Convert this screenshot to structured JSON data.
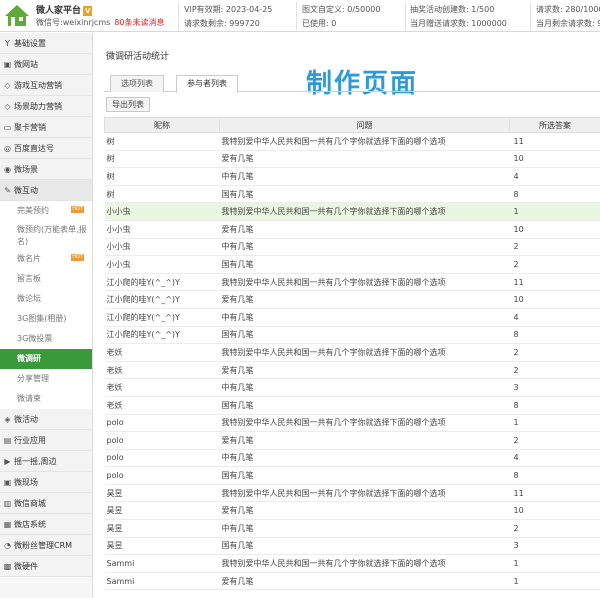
{
  "header": {
    "brand": "微人家平台",
    "vip_badge": "V",
    "wechat_id": "微信号:weixinrjcms",
    "unread": "80条未读消息",
    "stats": [
      {
        "label": "VIP有效期:",
        "value": "2023-04-25"
      },
      {
        "label": "请求数剩余:",
        "value": "999720"
      },
      {
        "label": "图文自定义:",
        "value": "0/50000"
      },
      {
        "label": "已使用:",
        "value": "0"
      },
      {
        "label": "抽奖活动创建数:",
        "value": "1/500"
      },
      {
        "label": "当月赠送请求数:",
        "value": "1000000"
      },
      {
        "label": "请求数:",
        "value": "280/1000"
      },
      {
        "label": "当月剩余请求数:",
        "value": "99"
      }
    ]
  },
  "sidebar": {
    "items": [
      {
        "icon": "Y",
        "label": "基础设置"
      },
      {
        "icon": "▣",
        "label": "微网站"
      },
      {
        "icon": "◇",
        "label": "游戏互动营销"
      },
      {
        "icon": "◇",
        "label": "场景助力营销"
      },
      {
        "icon": "▭",
        "label": "聚卡营销"
      },
      {
        "icon": "◎",
        "label": "百度直达号"
      },
      {
        "icon": "◉",
        "label": "微场景"
      },
      {
        "icon": "✎",
        "label": "微互动"
      }
    ],
    "sub_items": [
      {
        "label": "完美预约",
        "hot": "HOT"
      },
      {
        "label": "微预约(万能表单,报名)",
        "hot": ""
      },
      {
        "label": "微名片",
        "hot": "HOT"
      },
      {
        "label": "留言板",
        "hot": ""
      },
      {
        "label": "微论坛",
        "hot": ""
      },
      {
        "label": "3G图集(相册)",
        "hot": ""
      },
      {
        "label": "3G微投票",
        "hot": ""
      },
      {
        "label": "微调研",
        "hot": ""
      },
      {
        "label": "分享管理",
        "hot": ""
      },
      {
        "label": "微请柬",
        "hot": ""
      }
    ],
    "items_after": [
      {
        "icon": "◈",
        "label": "微活动"
      },
      {
        "icon": "▤",
        "label": "行业应用"
      },
      {
        "icon": "▶",
        "label": "摇一摇,周边"
      },
      {
        "icon": "▣",
        "label": "微现场"
      },
      {
        "icon": "▥",
        "label": "微信商城"
      },
      {
        "icon": "▦",
        "label": "微店系统"
      },
      {
        "icon": "◔",
        "label": "微粉丝管理CRM"
      },
      {
        "icon": "▩",
        "label": "微硬件"
      }
    ]
  },
  "main": {
    "title": "微调研活动统计",
    "banner": "制作页面",
    "tabs": [
      "选项列表",
      "参与者列表"
    ],
    "export_button": "导出列表",
    "columns": [
      "昵称",
      "问题",
      "所选答案"
    ],
    "rows": [
      [
        "树",
        "我特别爱中华人民共和国一共有几个字你就选择下面的哪个选项",
        "11"
      ],
      [
        "树",
        "爱有几笔",
        "10"
      ],
      [
        "树",
        "中有几笔",
        "4"
      ],
      [
        "树",
        "国有几笔",
        "8"
      ],
      [
        "小小虫",
        "我特别爱中华人民共和国一共有几个字你就选择下面的哪个选项",
        "1"
      ],
      [
        "小小虫",
        "爱有几笔",
        "10"
      ],
      [
        "小小虫",
        "中有几笔",
        "2"
      ],
      [
        "小小虫",
        "国有几笔",
        "2"
      ],
      [
        "江小爬的哇Y(^_^)Y",
        "我特别爱中华人民共和国一共有几个字你就选择下面的哪个选项",
        "11"
      ],
      [
        "江小爬的哇Y(^_^)Y",
        "爱有几笔",
        "10"
      ],
      [
        "江小爬的哇Y(^_^)Y",
        "中有几笔",
        "4"
      ],
      [
        "江小爬的哇Y(^_^)Y",
        "国有几笔",
        "8"
      ],
      [
        "老妖",
        "我特别爱中华人民共和国一共有几个字你就选择下面的哪个选项",
        "2"
      ],
      [
        "老妖",
        "爱有几笔",
        "2"
      ],
      [
        "老妖",
        "中有几笔",
        "3"
      ],
      [
        "老妖",
        "国有几笔",
        "8"
      ],
      [
        "polo",
        "我特别爱中华人民共和国一共有几个字你就选择下面的哪个选项",
        "1"
      ],
      [
        "polo",
        "爱有几笔",
        "2"
      ],
      [
        "polo",
        "中有几笔",
        "4"
      ],
      [
        "polo",
        "国有几笔",
        "8"
      ],
      [
        "昊昱",
        "我特别爱中华人民共和国一共有几个字你就选择下面的哪个选项",
        "11"
      ],
      [
        "昊昱",
        "爱有几笔",
        "10"
      ],
      [
        "昊昱",
        "中有几笔",
        "2"
      ],
      [
        "昊昱",
        "国有几笔",
        "3"
      ],
      [
        "Sammi",
        "我特别爱中华人民共和国一共有几个字你就选择下面的哪个选项",
        "1"
      ],
      [
        "Sammi",
        "爱有几笔",
        "1"
      ]
    ],
    "highlight_row": 4
  },
  "colors": {
    "active_green": "#3a9a3a",
    "banner_blue": "#2e9ad8",
    "unread_red": "#e02020"
  }
}
